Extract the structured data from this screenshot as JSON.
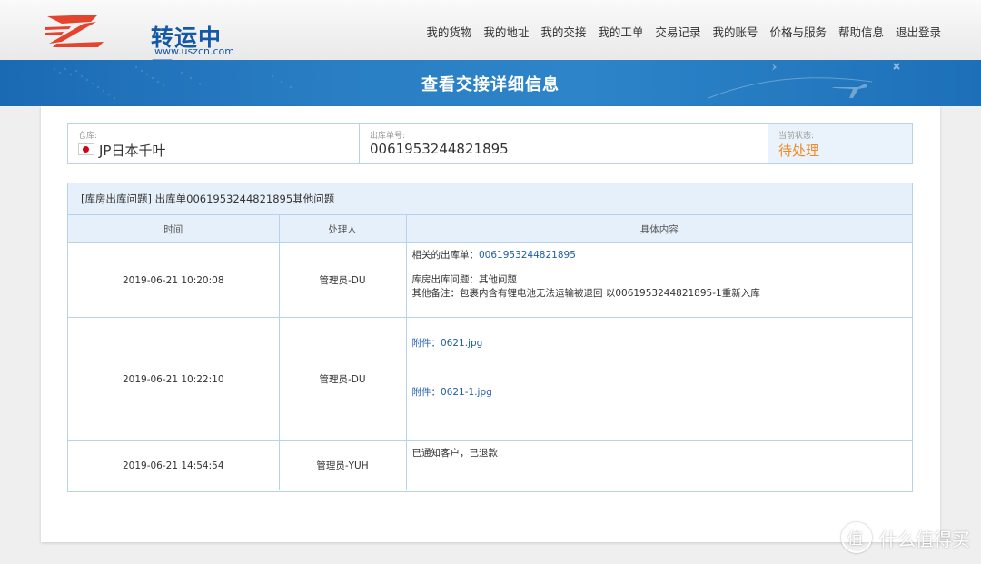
{
  "header": {
    "logo_text": "转运中国",
    "logo_url": "www.uszcn.com",
    "nav": [
      "我的货物",
      "我的地址",
      "我的交接",
      "我的工单",
      "交易记录",
      "我的账号",
      "价格与服务",
      "帮助信息",
      "退出登录"
    ]
  },
  "banner": {
    "title": "查看交接详细信息"
  },
  "info": {
    "warehouse_label": "仓库:",
    "warehouse_value": "JP日本千叶",
    "order_label": "出库单号:",
    "order_value": "0061953244821895",
    "status_label": "当前状态:",
    "status_value": "待处理"
  },
  "table": {
    "title": "[库房出库问题] 出库单0061953244821895其他问题",
    "headers": [
      "时间",
      "处理人",
      "具体内容"
    ],
    "rows": [
      {
        "time": "2019-06-21 10:20:08",
        "handler": "管理员-DU",
        "related_label": "相关的出库单：",
        "related_link": "0061953244821895",
        "line2": "库房出库问题：其他问题",
        "line3": "其他备注：包裹内含有锂电池无法运输被退回 以0061953244821895-1重新入库"
      },
      {
        "time": "2019-06-21 10:22:10",
        "handler": "管理员-DU",
        "attachment1": "附件：0621.jpg",
        "attachment2": "附件：0621-1.jpg"
      },
      {
        "time": "2019-06-21 14:54:54",
        "handler": "管理员-YUH",
        "content": "已通知客户，已退款"
      }
    ]
  },
  "watermark": "什么值得买",
  "colors": {
    "brand_blue": "#1a6ab3",
    "status_orange": "#f08a24",
    "border": "#b7d3ea"
  }
}
